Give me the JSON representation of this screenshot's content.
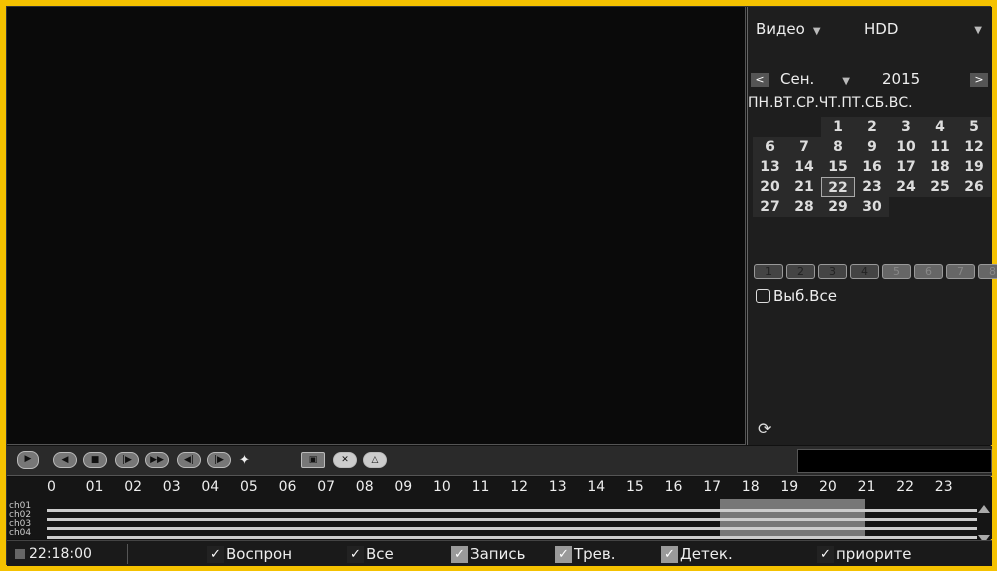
{
  "panel": {
    "type_select": "Видео",
    "storage_select": "HDD",
    "month": "Сен.",
    "year": "2015",
    "prev": "<",
    "next": ">",
    "weekdays": "ПН.ВТ.СР.ЧТ.ПТ.СБ.ВС.",
    "calendar_rows": [
      [
        "",
        "",
        "1",
        "2",
        "3",
        "4",
        "5"
      ],
      [
        "6",
        "7",
        "8",
        "9",
        "10",
        "11",
        "12"
      ],
      [
        "13",
        "14",
        "15",
        "16",
        "17",
        "18",
        "19"
      ],
      [
        "20",
        "21",
        "22",
        "23",
        "24",
        "25",
        "26"
      ],
      [
        "27",
        "28",
        "29",
        "30",
        "",
        "",
        ""
      ]
    ],
    "selected_day": "22",
    "channels": [
      "1",
      "2",
      "3",
      "4",
      "5",
      "6",
      "7",
      "8"
    ],
    "select_all": "Выб.Все",
    "refresh_icon": "refresh-icon"
  },
  "controls": {
    "icons": [
      "play-icon",
      "reverse-icon",
      "stop-icon",
      "step-play-icon",
      "fast-forward-icon",
      "slow-back-icon",
      "slow-forward-icon",
      "clip-icon",
      "fullscreen-icon",
      "close-icon",
      "backup-icon"
    ]
  },
  "timeline": {
    "hours": [
      "0",
      "01",
      "02",
      "03",
      "04",
      "05",
      "06",
      "07",
      "08",
      "09",
      "10",
      "11",
      "12",
      "13",
      "14",
      "15",
      "16",
      "17",
      "18",
      "19",
      "20",
      "21",
      "22",
      "23"
    ],
    "channels": [
      "ch01",
      "ch02",
      "ch03",
      "ch04"
    ]
  },
  "status": {
    "time": "22:18:00",
    "filters": [
      {
        "label": "Воспрон",
        "checked": true
      },
      {
        "label": "Все",
        "checked": true
      },
      {
        "label": "Запись",
        "checked": true
      },
      {
        "label": "Трев.",
        "checked": true
      },
      {
        "label": "Детек.",
        "checked": true
      },
      {
        "label": "приорите",
        "checked": true
      }
    ]
  }
}
